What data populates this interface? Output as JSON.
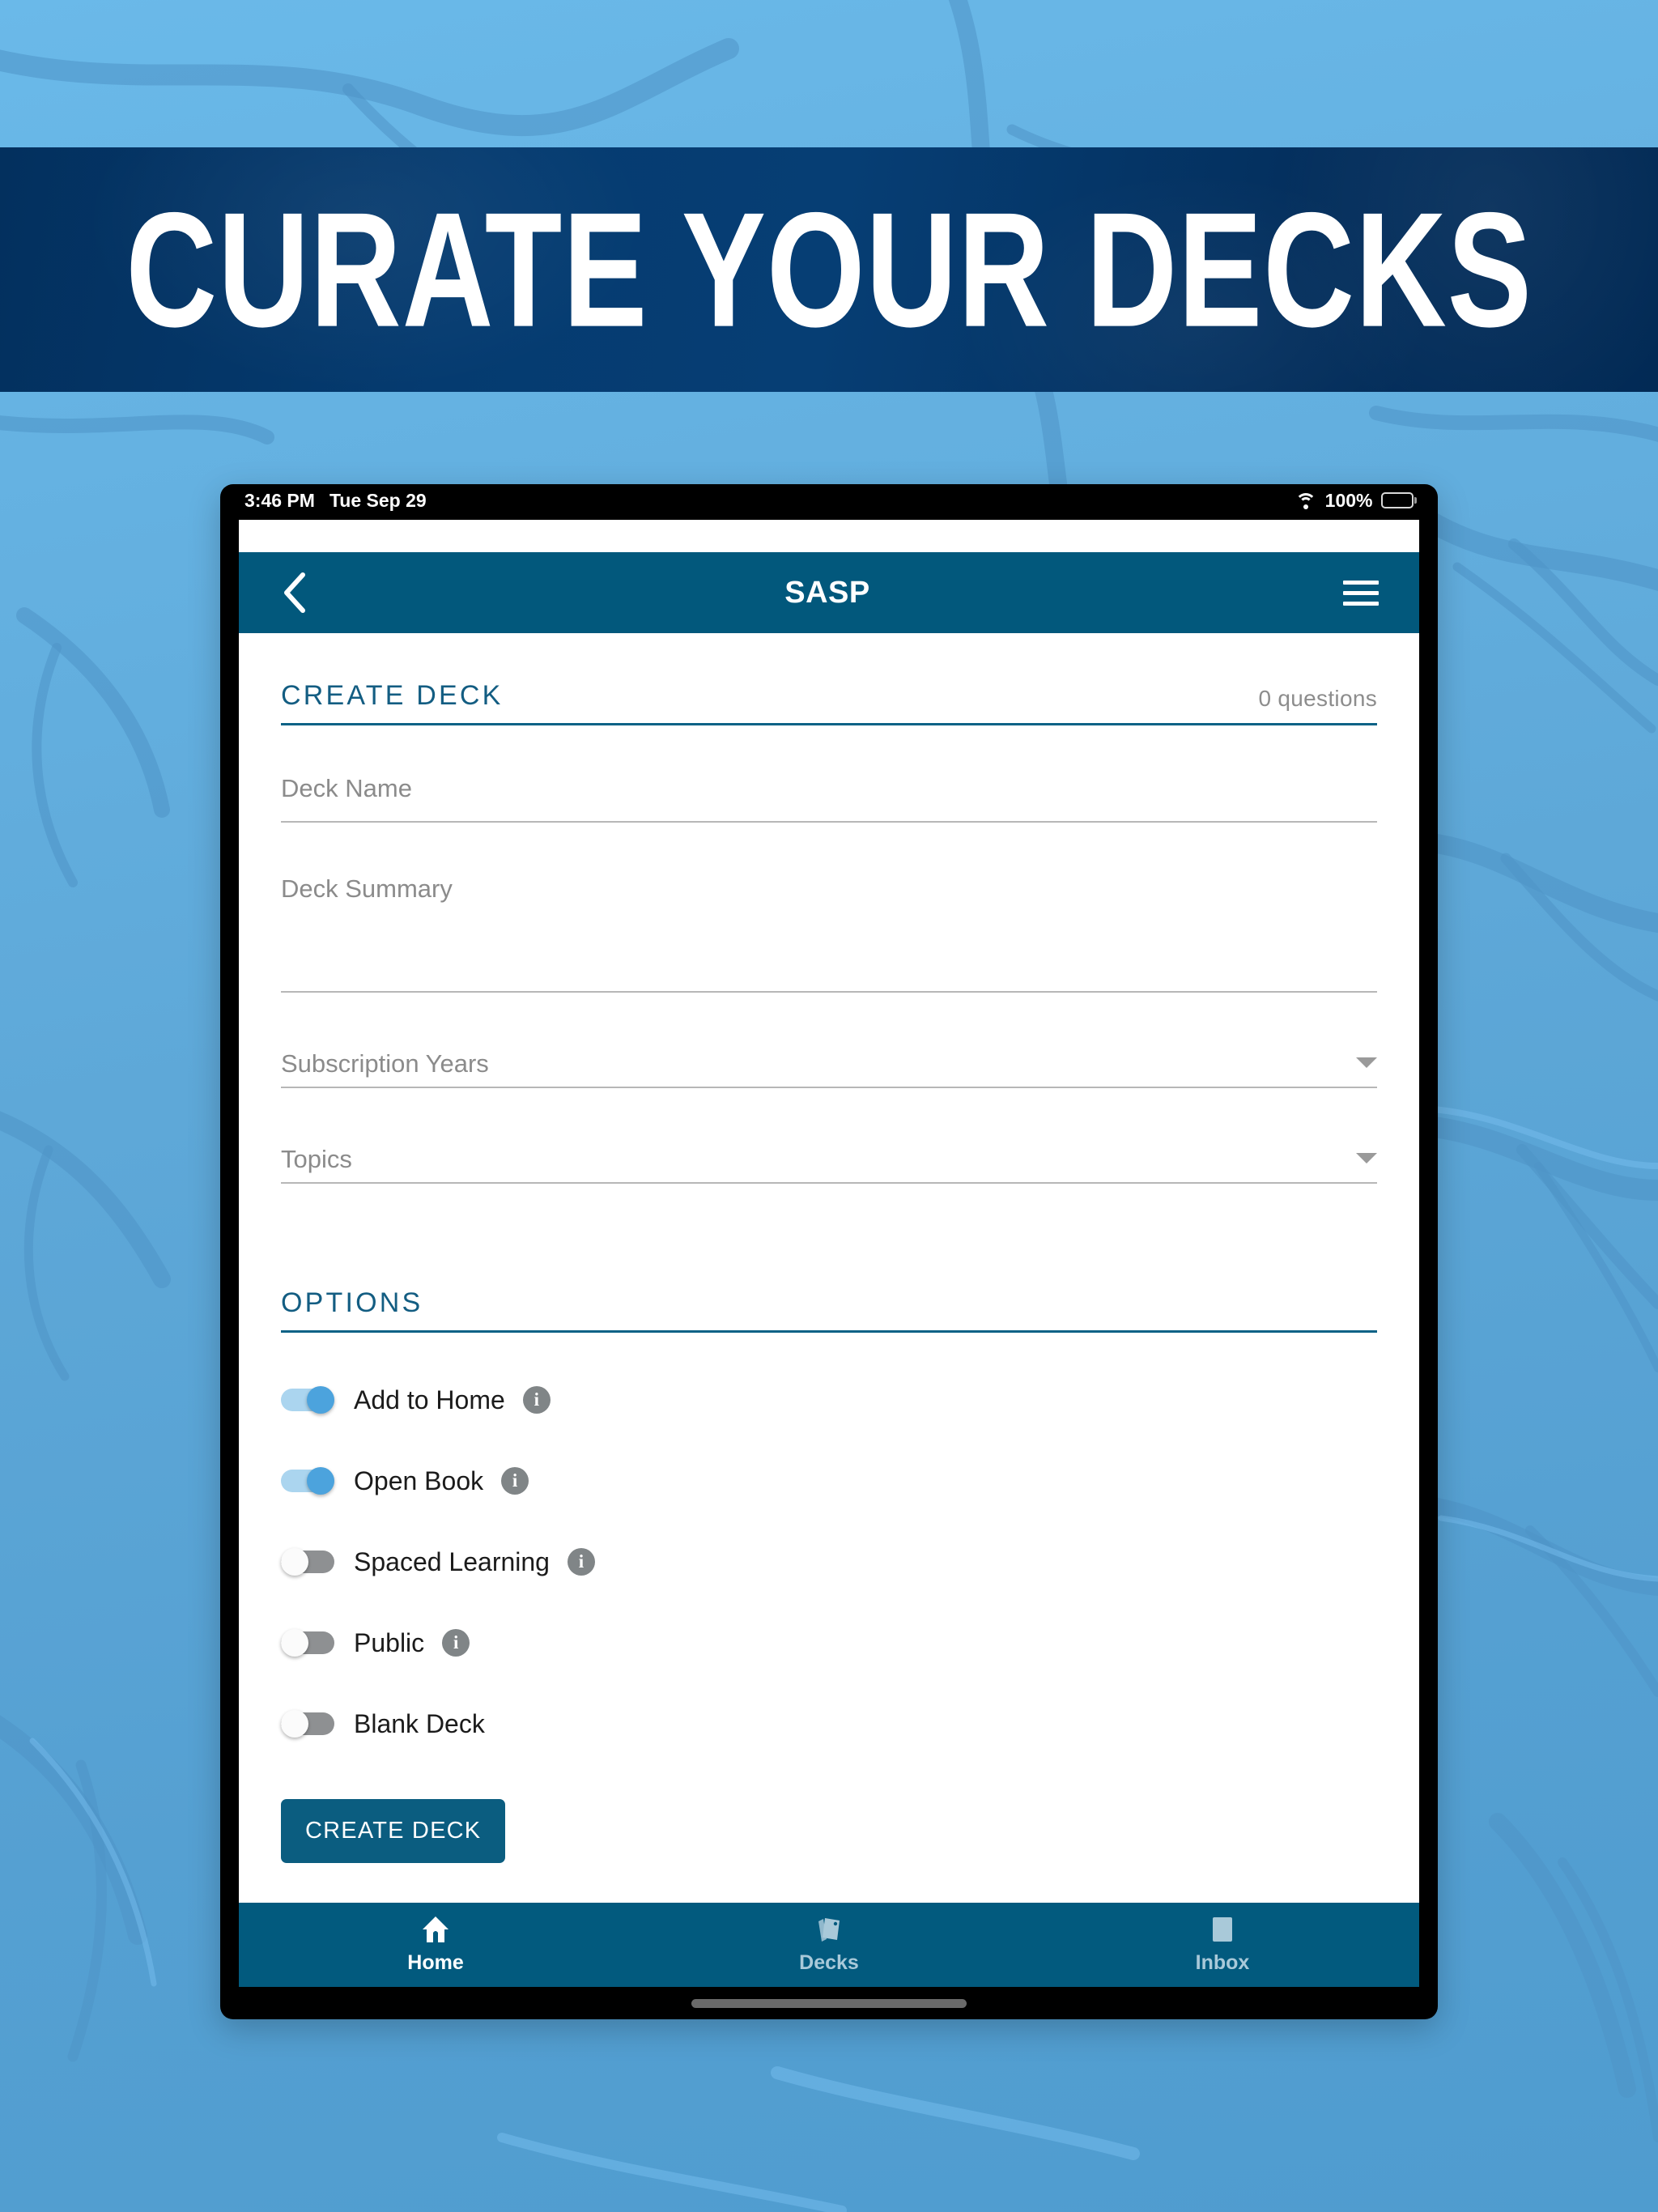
{
  "promo": {
    "headline": "CURATE YOUR DECKS",
    "banner_color": "#043a6e",
    "background_color": "#5ea8d8"
  },
  "status_bar": {
    "time": "3:46 PM",
    "date": "Tue Sep 29",
    "wifi_icon": "wifi-icon",
    "battery_percent": "100%",
    "battery_icon": "battery-icon"
  },
  "app_bar": {
    "back_icon": "chevron-left-icon",
    "title": "SASP",
    "menu_icon": "hamburger-menu-icon",
    "color": "#02587c"
  },
  "create_deck": {
    "section_title": "CREATE DECK",
    "question_count": "0 questions",
    "fields": [
      {
        "name": "deck-name",
        "placeholder": "Deck Name",
        "value": ""
      },
      {
        "name": "deck-summary",
        "placeholder": "Deck Summary",
        "value": ""
      }
    ],
    "selects": [
      {
        "name": "subscription-years",
        "label": "Subscription Years",
        "value": "",
        "caret_icon": "caret-down-icon"
      },
      {
        "name": "topics",
        "label": "Topics",
        "value": "",
        "caret_icon": "caret-down-icon"
      }
    ]
  },
  "options": {
    "section_title": "OPTIONS",
    "items": [
      {
        "label": "Add to Home",
        "state": "on",
        "has_info": true,
        "info_icon": "info-icon"
      },
      {
        "label": "Open Book",
        "state": "on",
        "has_info": true,
        "info_icon": "info-icon"
      },
      {
        "label": "Spaced Learning",
        "state": "off",
        "has_info": true,
        "info_icon": "info-icon"
      },
      {
        "label": "Public",
        "state": "off",
        "has_info": true,
        "info_icon": "info-icon"
      },
      {
        "label": "Blank Deck",
        "state": "off",
        "has_info": false,
        "info_icon": ""
      }
    ],
    "submit_label": "CREATE DECK",
    "submit_color": "#0b5d80"
  },
  "bottom_nav": {
    "items": [
      {
        "label": "Home",
        "icon": "home-icon",
        "active": true
      },
      {
        "label": "Decks",
        "icon": "cards-icon",
        "active": false
      },
      {
        "label": "Inbox",
        "icon": "inbox-icon",
        "active": false
      }
    ],
    "color": "#025a7e",
    "active_color": "#ffffff",
    "inactive_color": "#a9c9d9"
  }
}
